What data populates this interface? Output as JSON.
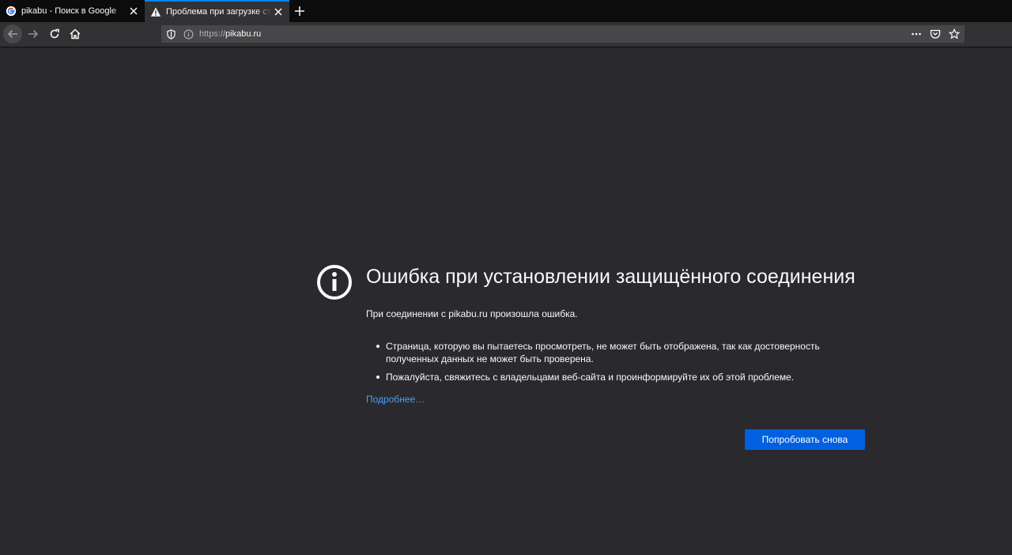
{
  "tabs": [
    {
      "title": "pikabu - Поиск в Google",
      "favicon": "google-icon",
      "active": false
    },
    {
      "title": "Проблема при загрузке страницы",
      "favicon": "warning-icon",
      "active": true
    }
  ],
  "toolbar": {
    "url_scheme": "https://",
    "url_host": "pikabu.ru"
  },
  "error": {
    "title": "Ошибка при установлении защищённого соединения",
    "intro": "При соединении с pikabu.ru произошла ошибка.",
    "bullets": [
      "Страница, которую вы пытаетесь просмотреть, не может быть отображена, так как достоверность полученных данных не может быть проверена.",
      "Пожалуйста, свяжитесь с владельцами веб-сайта и проинформируйте их об этой проблеме."
    ],
    "learn_more": "Подробнее…",
    "retry_button": "Попробовать снова"
  },
  "colors": {
    "background": "#2a2a2e",
    "tabbar": "#0c0c0d",
    "accent": "#0a84ff",
    "button": "#0060df",
    "link": "#45a1ff"
  }
}
